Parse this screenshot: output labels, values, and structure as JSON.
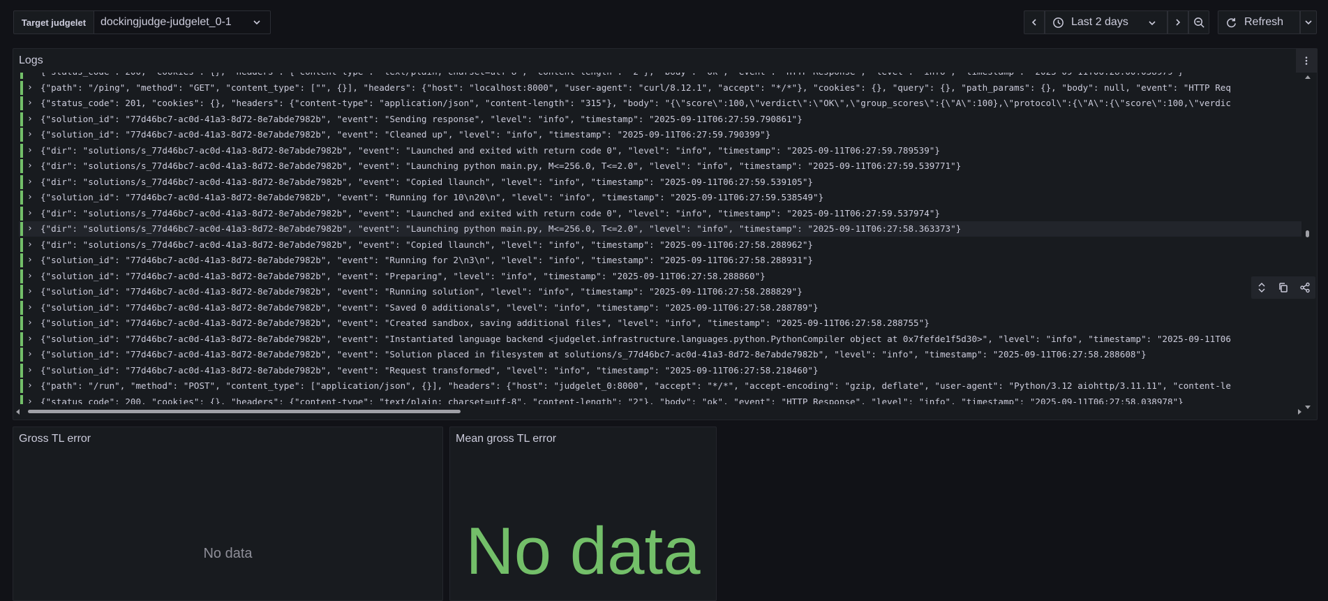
{
  "toolbar": {
    "variable_label": "Target judgelet",
    "variable_value": "dockingjudge-judgelet_0-1",
    "time_range": "Last 2 days",
    "refresh_label": "Refresh"
  },
  "logs_panel": {
    "title": "Logs",
    "partial_top": "{\"status_code\": 200, \"cookies\": {}, \"headers\": {\"content-type\": \"text/plain; charset=utf-8\", \"content-length\": \"2\"}, \"body\": \"ok\", \"event\": \"HTTP Response\", \"level\": \"info\", \"timestamp\": \"2025-09-11T06:28:00.038979\"}",
    "rows": [
      "{\"path\": \"/ping\", \"method\": \"GET\", \"content_type\": [\"\", {}], \"headers\": {\"host\": \"localhost:8000\", \"user-agent\": \"curl/8.12.1\", \"accept\": \"*/*\"}, \"cookies\": {}, \"query\": {}, \"path_params\": {}, \"body\": null, \"event\": \"HTTP Req",
      "{\"status_code\": 201, \"cookies\": {}, \"headers\": {\"content-type\": \"application/json\", \"content-length\": \"315\"}, \"body\": \"{\\\"score\\\":100,\\\"verdict\\\":\\\"OK\\\",\\\"group_scores\\\":{\\\"A\\\":100},\\\"protocol\\\":{\\\"A\\\":{\\\"score\\\":100,\\\"verdic",
      "{\"solution_id\": \"77d46bc7-ac0d-41a3-8d72-8e7abde7982b\", \"event\": \"Sending response\", \"level\": \"info\", \"timestamp\": \"2025-09-11T06:27:59.790861\"}",
      "{\"solution_id\": \"77d46bc7-ac0d-41a3-8d72-8e7abde7982b\", \"event\": \"Cleaned up\", \"level\": \"info\", \"timestamp\": \"2025-09-11T06:27:59.790399\"}",
      "{\"dir\": \"solutions/s_77d46bc7-ac0d-41a3-8d72-8e7abde7982b\", \"event\": \"Launched and exited with return code 0\", \"level\": \"info\", \"timestamp\": \"2025-09-11T06:27:59.789539\"}",
      "{\"dir\": \"solutions/s_77d46bc7-ac0d-41a3-8d72-8e7abde7982b\", \"event\": \"Launching python main.py, M<=256.0, T<=2.0\", \"level\": \"info\", \"timestamp\": \"2025-09-11T06:27:59.539771\"}",
      "{\"dir\": \"solutions/s_77d46bc7-ac0d-41a3-8d72-8e7abde7982b\", \"event\": \"Copied llaunch\", \"level\": \"info\", \"timestamp\": \"2025-09-11T06:27:59.539105\"}",
      "{\"solution_id\": \"77d46bc7-ac0d-41a3-8d72-8e7abde7982b\", \"event\": \"Running for 10\\n20\\n\", \"level\": \"info\", \"timestamp\": \"2025-09-11T06:27:59.538549\"}",
      "{\"dir\": \"solutions/s_77d46bc7-ac0d-41a3-8d72-8e7abde7982b\", \"event\": \"Launched and exited with return code 0\", \"level\": \"info\", \"timestamp\": \"2025-09-11T06:27:59.537974\"}",
      "{\"dir\": \"solutions/s_77d46bc7-ac0d-41a3-8d72-8e7abde7982b\", \"event\": \"Launching python main.py, M<=256.0, T<=2.0\", \"level\": \"info\", \"timestamp\": \"2025-09-11T06:27:58.363373\"}",
      "{\"dir\": \"solutions/s_77d46bc7-ac0d-41a3-8d72-8e7abde7982b\", \"event\": \"Copied llaunch\", \"level\": \"info\", \"timestamp\": \"2025-09-11T06:27:58.288962\"}",
      "{\"solution_id\": \"77d46bc7-ac0d-41a3-8d72-8e7abde7982b\", \"event\": \"Running for 2\\n3\\n\", \"level\": \"info\", \"timestamp\": \"2025-09-11T06:27:58.288931\"}",
      "{\"solution_id\": \"77d46bc7-ac0d-41a3-8d72-8e7abde7982b\", \"event\": \"Preparing\", \"level\": \"info\", \"timestamp\": \"2025-09-11T06:27:58.288860\"}",
      "{\"solution_id\": \"77d46bc7-ac0d-41a3-8d72-8e7abde7982b\", \"event\": \"Running solution\", \"level\": \"info\", \"timestamp\": \"2025-09-11T06:27:58.288829\"}",
      "{\"solution_id\": \"77d46bc7-ac0d-41a3-8d72-8e7abde7982b\", \"event\": \"Saved 0 additionals\", \"level\": \"info\", \"timestamp\": \"2025-09-11T06:27:58.288789\"}",
      "{\"solution_id\": \"77d46bc7-ac0d-41a3-8d72-8e7abde7982b\", \"event\": \"Created sandbox, saving additional files\", \"level\": \"info\", \"timestamp\": \"2025-09-11T06:27:58.288755\"}",
      "{\"solution_id\": \"77d46bc7-ac0d-41a3-8d72-8e7abde7982b\", \"event\": \"Instantiated language backend <judgelet.infrastructure.languages.python.PythonCompiler object at 0x7fefde1f5d30>\", \"level\": \"info\", \"timestamp\": \"2025-09-11T06",
      "{\"solution_id\": \"77d46bc7-ac0d-41a3-8d72-8e7abde7982b\", \"event\": \"Solution placed in filesystem at solutions/s_77d46bc7-ac0d-41a3-8d72-8e7abde7982b\", \"level\": \"info\", \"timestamp\": \"2025-09-11T06:27:58.288608\"}",
      "{\"solution_id\": \"77d46bc7-ac0d-41a3-8d72-8e7abde7982b\", \"event\": \"Request transformed\", \"level\": \"info\", \"timestamp\": \"2025-09-11T06:27:58.218460\"}",
      "{\"path\": \"/run\", \"method\": \"POST\", \"content_type\": [\"application/json\", {}], \"headers\": {\"host\": \"judgelet_0:8000\", \"accept\": \"*/*\", \"accept-encoding\": \"gzip, deflate\", \"user-agent\": \"Python/3.12 aiohttp/3.11.11\", \"content-le"
    ],
    "partial_bottom": "{\"status_code\": 200, \"cookies\": {}, \"headers\": {\"content-type\": \"text/plain; charset=utf-8\", \"content-length\": \"2\"}, \"body\": \"ok\", \"event\": \"HTTP Response\", \"level\": \"info\", \"timestamp\": \"2025-09-11T06:27:58.038978\"}",
    "highlighted_row": 9
  },
  "gross_panel": {
    "title": "Gross TL error",
    "nodata": "No data"
  },
  "mean_panel": {
    "title": "Mean gross TL error",
    "nodata": "No data"
  },
  "colors": {
    "level_info": "#73bf69",
    "background": "#111217",
    "panel": "#181b1f"
  }
}
